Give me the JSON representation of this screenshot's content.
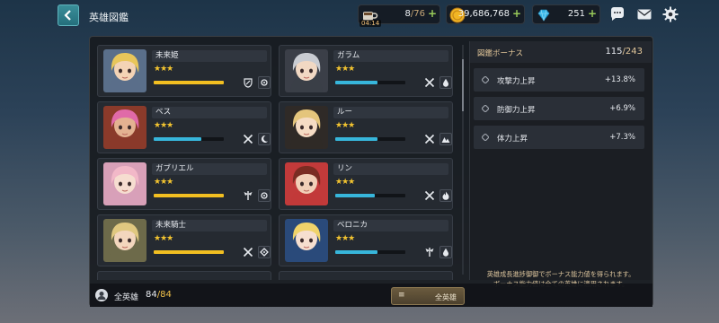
{
  "header": {
    "title": "英雄図鑑",
    "stamina": {
      "current": "8",
      "max": "/76",
      "timer": "04:14",
      "icon": "coffee-cup-icon"
    },
    "gold": {
      "value": "39,686,768",
      "icon": "gold-coin-icon"
    },
    "gems": {
      "value": "251",
      "icon": "blue-gem-icon"
    },
    "icons": [
      "chat-bubble-icon",
      "mail-icon",
      "gear-icon"
    ]
  },
  "heroes": [
    {
      "name": "未来姫",
      "stars": "★★★",
      "progress": 1.0,
      "bar": "gold",
      "class_icon": "shield-sword-icon",
      "element_icon": "gear-element-icon",
      "hair": "#e8c65a",
      "skin": "#f3d3b5",
      "accent": "#5a6f8a"
    },
    {
      "name": "ガラム",
      "stars": "★★★",
      "progress": 0.6,
      "bar": "blue",
      "class_icon": "crossed-swords-icon",
      "element_icon": "water-drop-icon",
      "hair": "#c9ccd2",
      "skin": "#f1d8c3",
      "accent": "#3b3f48"
    },
    {
      "name": "ベス",
      "stars": "★★★",
      "progress": 0.68,
      "bar": "blue",
      "class_icon": "crossed-swords-icon",
      "element_icon": "crescent-moon-icon",
      "hair": "#e06aa8",
      "skin": "#e3b291",
      "accent": "#8a3a2a"
    },
    {
      "name": "ルー",
      "stars": "★★★",
      "progress": 0.6,
      "bar": "blue",
      "class_icon": "crossed-swords-icon",
      "element_icon": "mountain-icon",
      "hair": "#e4c57c",
      "skin": "#f5dcc4",
      "accent": "#2f2a27"
    },
    {
      "name": "ガブリエル",
      "stars": "★★★",
      "progress": 1.0,
      "bar": "gold",
      "class_icon": "winged-staff-icon",
      "element_icon": "gear-element-icon",
      "hair": "#f2b8c8",
      "skin": "#f6ddd0",
      "accent": "#d8a0b8"
    },
    {
      "name": "リン",
      "stars": "★★★",
      "progress": 0.56,
      "bar": "blue",
      "class_icon": "crossed-swords-icon",
      "element_icon": "flame-icon",
      "hair": "#7a2c22",
      "skin": "#f2d0b8",
      "accent": "#c23a3a"
    },
    {
      "name": "未来騎士",
      "stars": "★★★",
      "progress": 1.0,
      "bar": "gold",
      "class_icon": "crossed-swords-icon",
      "element_icon": "diamond-element-icon",
      "hair": "#e0c880",
      "skin": "#f3d6bd",
      "accent": "#6d6a4a"
    },
    {
      "name": "ベロニカ",
      "stars": "★★★",
      "progress": 0.6,
      "bar": "blue",
      "class_icon": "winged-staff-icon",
      "element_icon": "water-drop-icon",
      "hair": "#f0d36a",
      "skin": "#f6dfcf",
      "accent": "#2a4a7a"
    }
  ],
  "bonus": {
    "title": "図鑑ボーナス",
    "current": "115",
    "max": "/243",
    "stats": [
      {
        "name": "攻撃力上昇",
        "value": "+13.8%"
      },
      {
        "name": "防御力上昇",
        "value": "+6.9%"
      },
      {
        "name": "体力上昇",
        "value": "+7.3%"
      }
    ],
    "note_line1": "英雄成長進捗御御でボーナス能力値を得られます。",
    "note_line2": "ボーナス能力値は全ての英雄に適用されます。"
  },
  "footer": {
    "label": "全英雄",
    "count_current": "84",
    "count_max": "/84",
    "filter_label": "全英雄"
  },
  "colors": {
    "gold_bar": "#f2bf21",
    "blue_bar": "#37b6db",
    "star": "#f3c430",
    "back_button": "#2f8390"
  }
}
